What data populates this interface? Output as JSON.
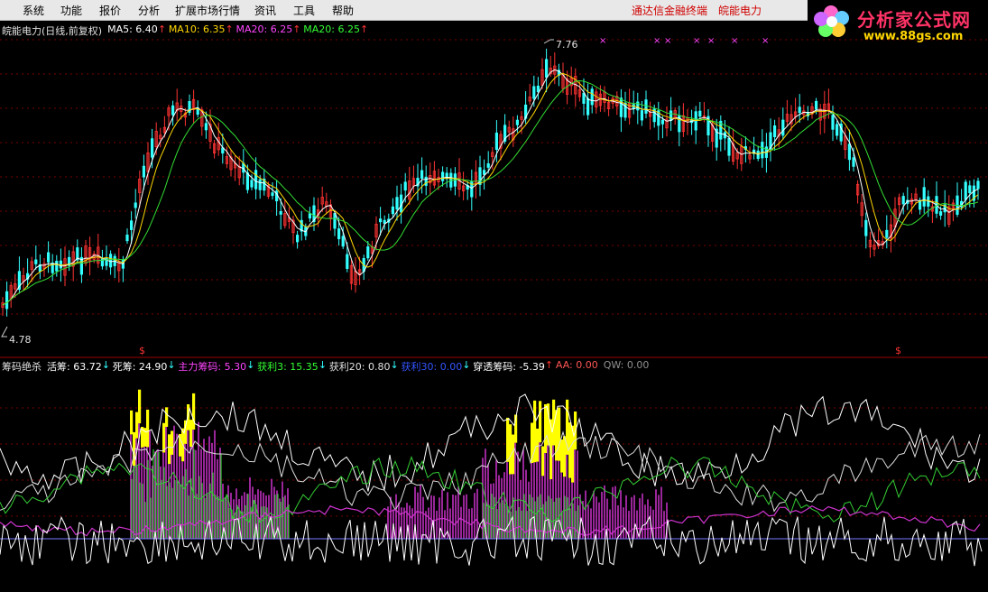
{
  "menu": {
    "items": [
      "系统",
      "功能",
      "报价",
      "分析",
      "扩展市场行情",
      "资讯",
      "工具",
      "帮助"
    ],
    "right_links": [
      "通达信金融终端",
      "皖能电力"
    ]
  },
  "logo": {
    "title": "分析家公式网",
    "url": "www.88gs.com"
  },
  "price_panel": {
    "legend": [
      {
        "label": "皖能电力(日线,前复权)",
        "color": "#e0e0e0"
      },
      {
        "label": "MA5: 6.40",
        "color": "#ffffff",
        "arrow": "↑"
      },
      {
        "label": "MA10: 6.35",
        "color": "#ffd700",
        "arrow": "↑"
      },
      {
        "label": "MA20: 6.25",
        "color": "#ff44ff",
        "arrow": "↑"
      },
      {
        "label": "MA20: 6.25",
        "color": "#33ff33",
        "arrow": "↑"
      }
    ],
    "high_label": "7.76",
    "low_label": "4.78"
  },
  "indicator_panel": {
    "legend": [
      {
        "label": "筹码绝杀",
        "color": "#e0e0e0",
        "arrow": ""
      },
      {
        "label": "活筹: 63.72",
        "color": "#ffffff",
        "arrow": "↓"
      },
      {
        "label": "死筹: 24.90",
        "color": "#ffffff",
        "arrow": "↓"
      },
      {
        "label": "主力筹码: 5.30",
        "color": "#ff44ff",
        "arrow": "↓"
      },
      {
        "label": "获利3: 15.35",
        "color": "#33ff33",
        "arrow": "↓"
      },
      {
        "label": "获利20: 0.80",
        "color": "#e0e0e0",
        "arrow": "↓"
      },
      {
        "label": "获利30: 0.00",
        "color": "#3355ff",
        "arrow": "↓"
      },
      {
        "label": "穿透筹码: -5.39",
        "color": "#ffffff",
        "arrow": "↑"
      },
      {
        "label": "AA: 0.00",
        "color": "#ff5555",
        "arrow": ""
      },
      {
        "label": "QW: 0.00",
        "color": "#909090",
        "arrow": ""
      }
    ],
    "markers": [
      "$",
      "$"
    ]
  },
  "colors": {
    "up": "#ff3333",
    "down": "#33ffff",
    "grid": "#8b0000"
  }
}
